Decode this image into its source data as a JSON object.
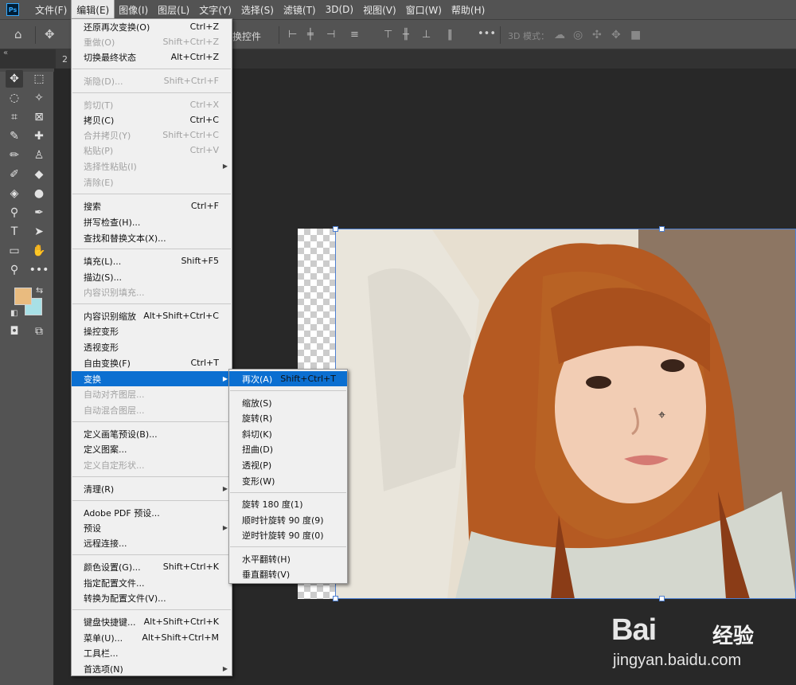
{
  "app": {
    "logo": "Ps"
  },
  "menubar": [
    "文件(F)",
    "编辑(E)",
    "图像(I)",
    "图层(L)",
    "文字(Y)",
    "选择(S)",
    "滤镜(T)",
    "3D(D)",
    "视图(V)",
    "窗口(W)",
    "帮助(H)"
  ],
  "options": {
    "transform_controls_label": "换控件",
    "mode3d_label": "3D 模式："
  },
  "tab_label": "2",
  "colors": {
    "foreground": "#e9bb7f",
    "background": "#a8e0e6",
    "accent": "#0b6fd1"
  },
  "edit_menu": [
    {
      "label": "还原再次变换(O)",
      "shortcut": "Ctrl+Z",
      "disabled": false
    },
    {
      "label": "重做(O)",
      "shortcut": "Shift+Ctrl+Z",
      "disabled": true
    },
    {
      "label": "切换最终状态",
      "shortcut": "Alt+Ctrl+Z",
      "disabled": false
    },
    {
      "label": "渐隐(D)...",
      "shortcut": "Shift+Ctrl+F",
      "disabled": true
    },
    {
      "label": "剪切(T)",
      "shortcut": "Ctrl+X",
      "disabled": true
    },
    {
      "label": "拷贝(C)",
      "shortcut": "Ctrl+C",
      "disabled": false
    },
    {
      "label": "合并拷贝(Y)",
      "shortcut": "Shift+Ctrl+C",
      "disabled": true
    },
    {
      "label": "粘贴(P)",
      "shortcut": "Ctrl+V",
      "disabled": true
    },
    {
      "label": "选择性粘贴(I)",
      "shortcut": "",
      "disabled": true,
      "submenu": true
    },
    {
      "label": "清除(E)",
      "shortcut": "",
      "disabled": true
    },
    {
      "label": "搜索",
      "shortcut": "Ctrl+F",
      "disabled": false
    },
    {
      "label": "拼写检查(H)...",
      "shortcut": "",
      "disabled": false
    },
    {
      "label": "查找和替换文本(X)...",
      "shortcut": "",
      "disabled": false
    },
    {
      "label": "填充(L)...",
      "shortcut": "Shift+F5",
      "disabled": false
    },
    {
      "label": "描边(S)...",
      "shortcut": "",
      "disabled": false
    },
    {
      "label": "内容识别填充...",
      "shortcut": "",
      "disabled": true
    },
    {
      "label": "内容识别缩放",
      "shortcut": "Alt+Shift+Ctrl+C",
      "disabled": false
    },
    {
      "label": "操控变形",
      "shortcut": "",
      "disabled": false
    },
    {
      "label": "透视变形",
      "shortcut": "",
      "disabled": false
    },
    {
      "label": "自由变换(F)",
      "shortcut": "Ctrl+T",
      "disabled": false
    },
    {
      "label": "变换",
      "shortcut": "",
      "disabled": false,
      "submenu": true,
      "highlighted": true
    },
    {
      "label": "自动对齐图层...",
      "shortcut": "",
      "disabled": true
    },
    {
      "label": "自动混合图层...",
      "shortcut": "",
      "disabled": true
    },
    {
      "label": "定义画笔预设(B)...",
      "shortcut": "",
      "disabled": false
    },
    {
      "label": "定义图案...",
      "shortcut": "",
      "disabled": false
    },
    {
      "label": "定义自定形状...",
      "shortcut": "",
      "disabled": true
    },
    {
      "label": "清理(R)",
      "shortcut": "",
      "disabled": false,
      "submenu": true
    },
    {
      "label": "Adobe PDF 预设...",
      "shortcut": "",
      "disabled": false
    },
    {
      "label": "预设",
      "shortcut": "",
      "disabled": false,
      "submenu": true
    },
    {
      "label": "远程连接...",
      "shortcut": "",
      "disabled": false
    },
    {
      "label": "颜色设置(G)...",
      "shortcut": "Shift+Ctrl+K",
      "disabled": false
    },
    {
      "label": "指定配置文件...",
      "shortcut": "",
      "disabled": false
    },
    {
      "label": "转换为配置文件(V)...",
      "shortcut": "",
      "disabled": false
    },
    {
      "label": "键盘快捷键...",
      "shortcut": "Alt+Shift+Ctrl+K",
      "disabled": false
    },
    {
      "label": "菜单(U)...",
      "shortcut": "Alt+Shift+Ctrl+M",
      "disabled": false
    },
    {
      "label": "工具栏...",
      "shortcut": "",
      "disabled": false
    },
    {
      "label": "首选项(N)",
      "shortcut": "",
      "disabled": false,
      "submenu": true
    }
  ],
  "transform_submenu": [
    {
      "label": "再次(A)",
      "shortcut": "Shift+Ctrl+T",
      "highlighted": true
    },
    {
      "label": "缩放(S)",
      "shortcut": ""
    },
    {
      "label": "旋转(R)",
      "shortcut": ""
    },
    {
      "label": "斜切(K)",
      "shortcut": ""
    },
    {
      "label": "扭曲(D)",
      "shortcut": ""
    },
    {
      "label": "透视(P)",
      "shortcut": ""
    },
    {
      "label": "变形(W)",
      "shortcut": ""
    },
    {
      "label": "旋转 180 度(1)",
      "shortcut": ""
    },
    {
      "label": "顺时针旋转 90 度(9)",
      "shortcut": ""
    },
    {
      "label": "逆时针旋转 90 度(0)",
      "shortcut": ""
    },
    {
      "label": "水平翻转(H)",
      "shortcut": ""
    },
    {
      "label": "垂直翻转(V)",
      "shortcut": ""
    }
  ],
  "watermark": {
    "logo": "Bai",
    "cn": "经验",
    "url": "jingyan.baidu.com"
  }
}
